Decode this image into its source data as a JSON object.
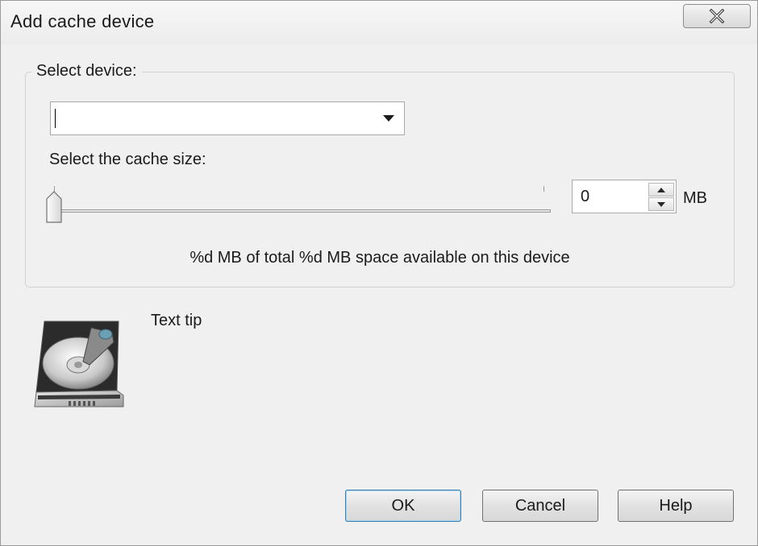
{
  "window": {
    "title": "Add cache device"
  },
  "device": {
    "label": "Select device:",
    "value": ""
  },
  "cache": {
    "label": "Select the cache size:",
    "size_value": "0",
    "unit": "MB"
  },
  "info": {
    "space_text": "%d MB of total %d MB space available on this device"
  },
  "tip": {
    "text": "Text tip"
  },
  "buttons": {
    "ok": "OK",
    "cancel": "Cancel",
    "help": "Help"
  },
  "icons": {
    "close": "close-icon",
    "dropdown": "chevron-down-icon",
    "spin_up": "arrow-up-icon",
    "spin_down": "arrow-down-icon",
    "device": "hard-drive-icon"
  },
  "colors": {
    "default_button_border": "#3c7fb1",
    "dialog_background": "#f0f0f0"
  }
}
